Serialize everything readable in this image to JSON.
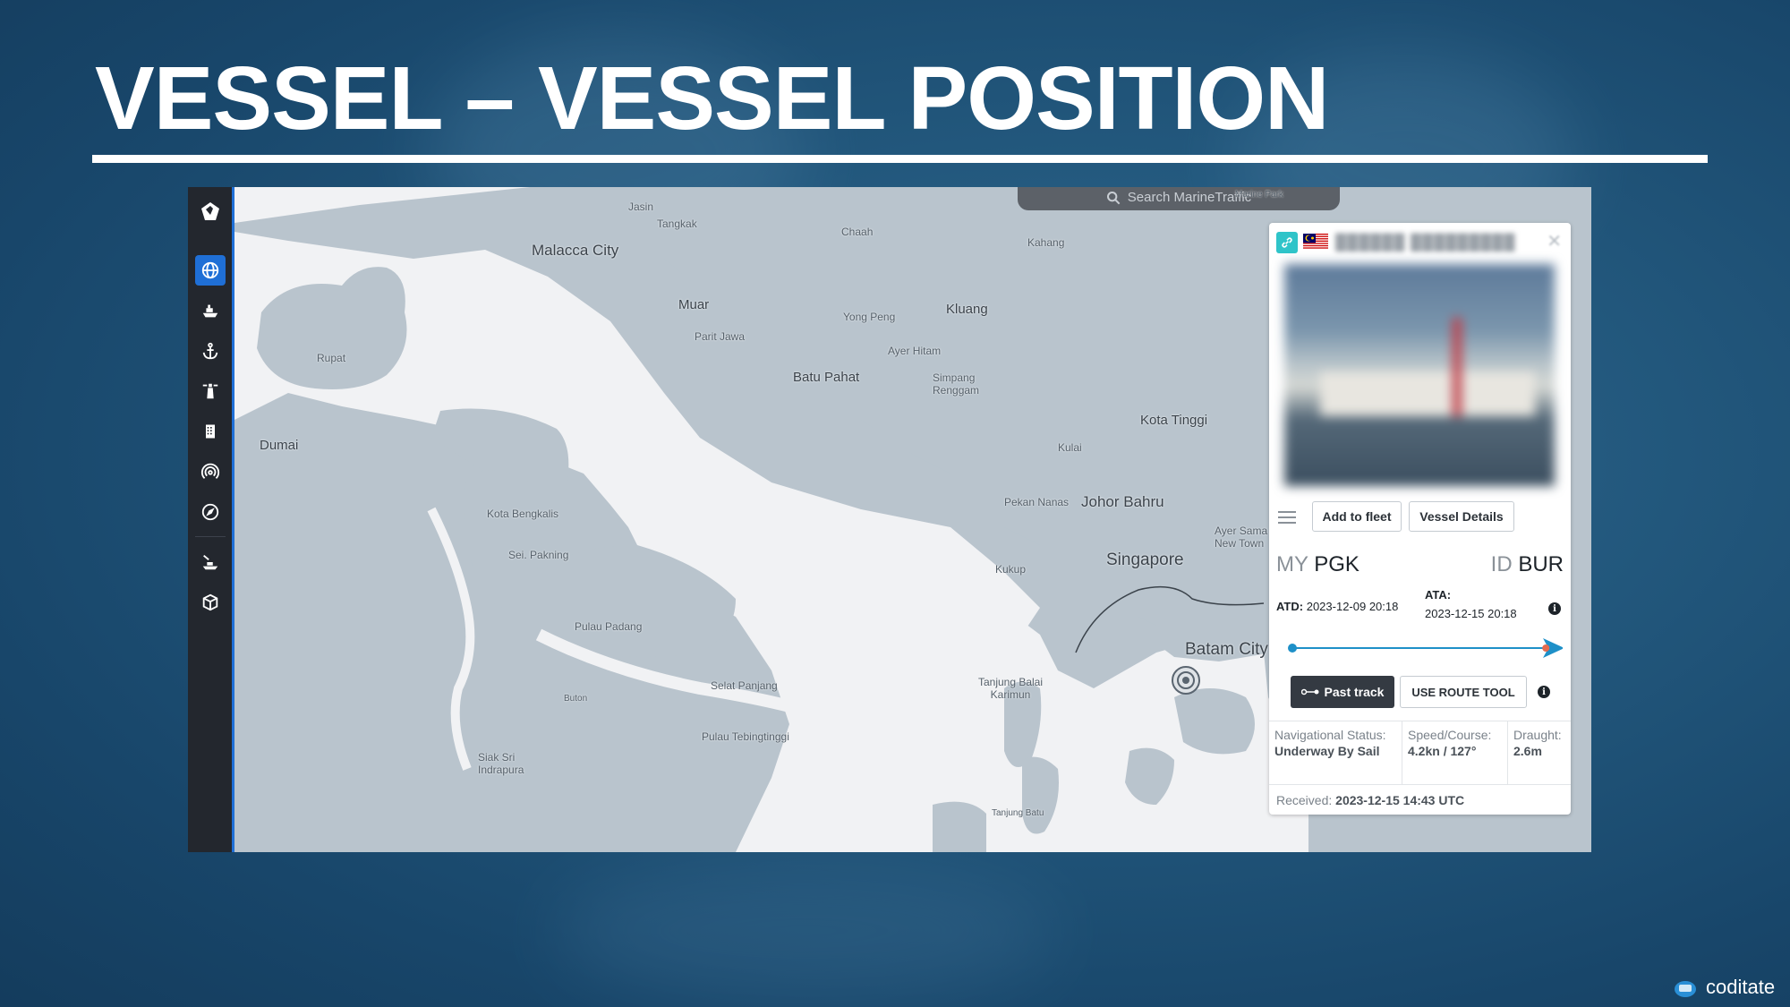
{
  "slide": {
    "title": "VESSEL – VESSEL POSITION",
    "brand": "coditate"
  },
  "sidebar": {
    "items": [
      {
        "icon": "logo-icon"
      },
      {
        "icon": "globe-icon",
        "active": true
      },
      {
        "icon": "ship-icon"
      },
      {
        "icon": "anchor-icon"
      },
      {
        "icon": "lighthouse-icon"
      },
      {
        "icon": "building-icon"
      },
      {
        "icon": "signal-icon"
      },
      {
        "icon": "compass-icon"
      },
      {
        "icon": "ship-route-icon"
      },
      {
        "icon": "cube-icon"
      }
    ]
  },
  "map": {
    "search_placeholder": "Search MarineTraffic",
    "top_right_text": "Marine Park",
    "places": {
      "jasin": "Jasin",
      "tangkak": "Tangkak",
      "malacca_city": "Malacca City",
      "chaah": "Chaah",
      "kahang": "Kahang",
      "muar": "Muar",
      "parit_jawa": "Parit Jawa",
      "yong_peng": "Yong Peng",
      "kluang": "Kluang",
      "ayer_hitam": "Ayer Hitam",
      "batu_pahat": "Batu Pahat",
      "simpang_renggam": "Simpang Renggam",
      "rupat": "Rupat",
      "kota_tinggi": "Kota Tinggi",
      "dumai": "Dumai",
      "kulai": "Kulai",
      "pekan_nanas": "Pekan Nanas",
      "johor_bahru": "Johor Bahru",
      "ayer_sama_new_town": "Ayer Sama New Town",
      "kota_bengkalis": "Kota Bengkalis",
      "sei_pakning": "Sei. Pakning",
      "kukup": "Kukup",
      "singapore": "Singapore",
      "pulau_padang": "Pulau Padang",
      "batam_city": "Batam City",
      "selat_panjang": "Selat Panjang",
      "buton": "Buton",
      "tanjung_balai_karimun": "Tanjung Balai Karimun",
      "pulau_tebingtinggi": "Pulau Tebingtinggi",
      "siak_sri_indrapura": "Siak Sri Indrapura",
      "tanjung_batu": "Tanjung Batu"
    }
  },
  "panel": {
    "add_to_fleet": "Add to fleet",
    "vessel_details": "Vessel Details",
    "departure": {
      "country": "MY",
      "port": "PGK"
    },
    "arrival": {
      "country": "ID",
      "port": "BUR"
    },
    "atd_label": "ATD:",
    "atd_value": "2023-12-09 20:18",
    "ata_label": "ATA:",
    "ata_value": "2023-12-15 20:18",
    "info_glyph": "i",
    "past_track": "Past track",
    "use_route_tool": "USE ROUTE TOOL",
    "nav_status_label": "Navigational Status:",
    "nav_status_value": "Underway By Sail",
    "speed_label": "Speed/Course:",
    "speed_value": "4.2kn / 127°",
    "draught_label": "Draught:",
    "draught_value": "2.6m",
    "received_label": "Received:",
    "received_value": "2023-12-15 14:43 UTC",
    "route_progress": 0.97,
    "accent_color": "#1e90c8"
  }
}
